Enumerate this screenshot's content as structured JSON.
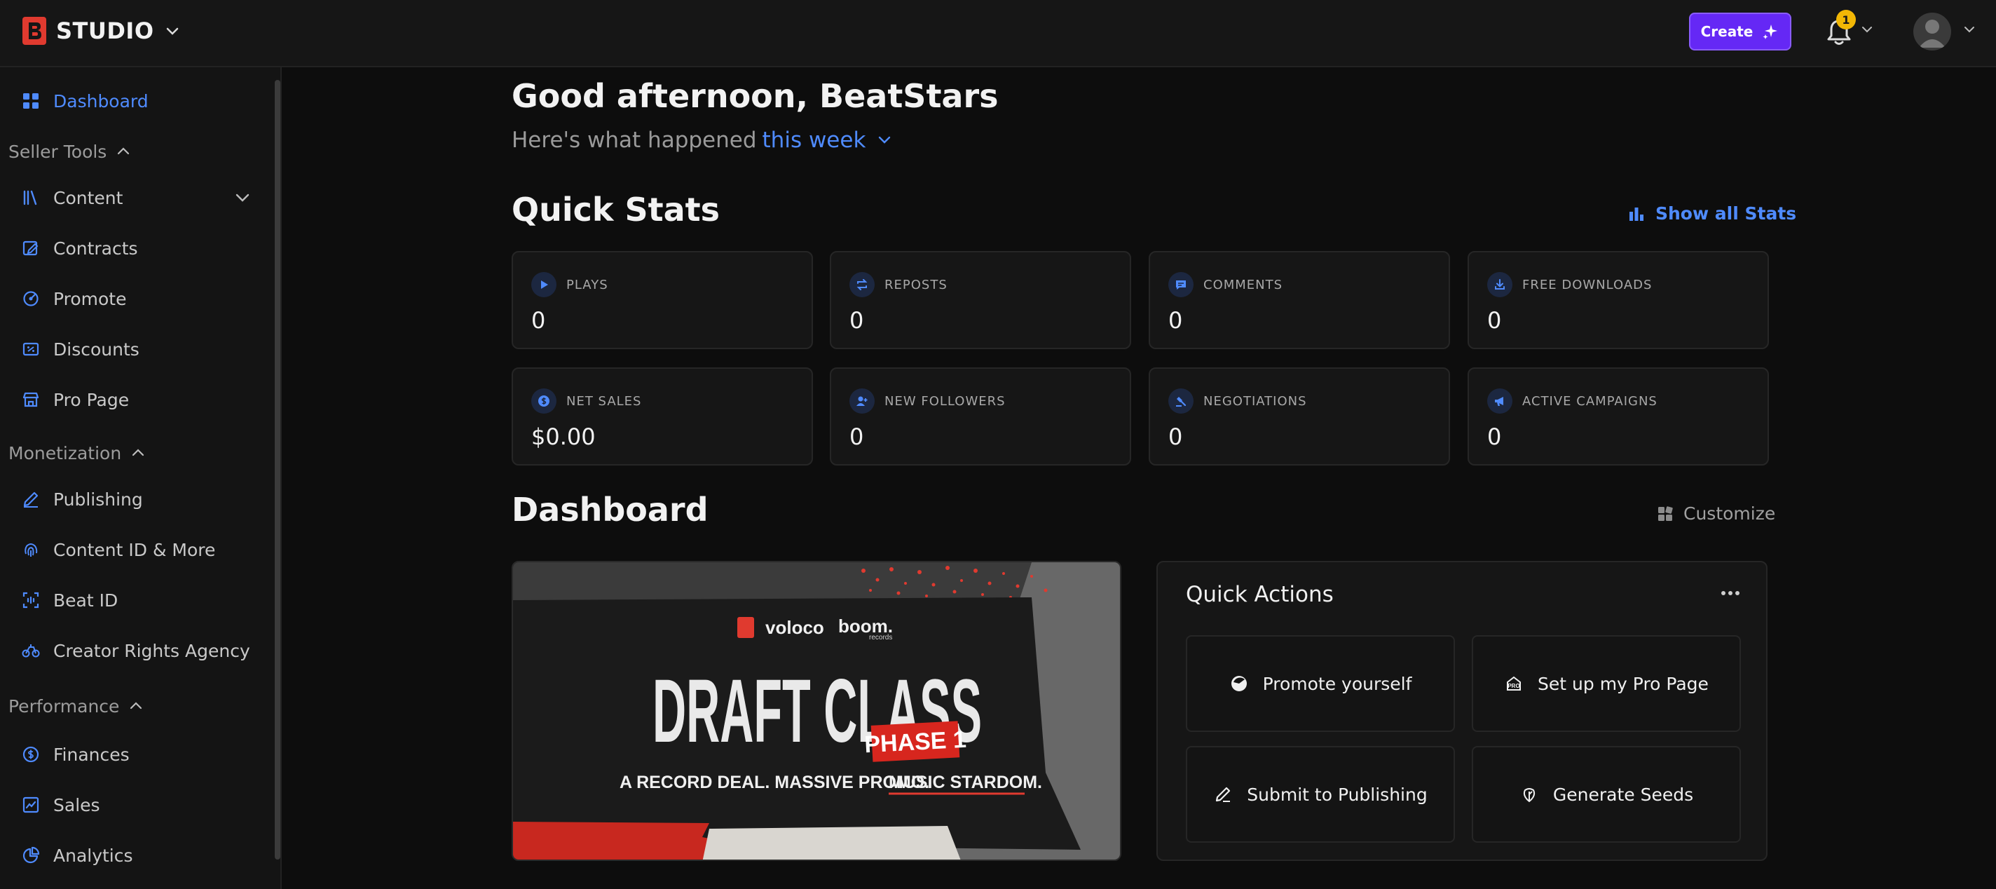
{
  "header": {
    "brand": "STUDIO",
    "create_label": "Create",
    "notification_count": "1"
  },
  "sidebar": {
    "dashboard": "Dashboard",
    "sections": {
      "seller_tools": "Seller Tools",
      "monetization": "Monetization",
      "performance": "Performance"
    },
    "items": {
      "content": "Content",
      "contracts": "Contracts",
      "promote": "Promote",
      "discounts": "Discounts",
      "pro_page": "Pro Page",
      "publishing": "Publishing",
      "content_id": "Content ID & More",
      "beat_id": "Beat ID",
      "creator_rights": "Creator Rights Agency",
      "finances": "Finances",
      "sales": "Sales",
      "analytics": "Analytics"
    }
  },
  "main": {
    "greeting": "Good afternoon, BeatStars",
    "subtitle_prefix": "Here's what happened",
    "period": "this week",
    "quick_stats_title": "Quick Stats",
    "show_all_stats": "Show all Stats",
    "stats": [
      {
        "label": "PLAYS",
        "value": "0"
      },
      {
        "label": "REPOSTS",
        "value": "0"
      },
      {
        "label": "COMMENTS",
        "value": "0"
      },
      {
        "label": "FREE DOWNLOADS",
        "value": "0"
      },
      {
        "label": "NET SALES",
        "value": "$0.00"
      },
      {
        "label": "NEW FOLLOWERS",
        "value": "0"
      },
      {
        "label": "NEGOTIATIONS",
        "value": "0"
      },
      {
        "label": "ACTIVE CAMPAIGNS",
        "value": "0"
      }
    ],
    "dashboard_title": "Dashboard",
    "customize": "Customize",
    "banner": {
      "brand_left": "voloco",
      "brand_right": "boom.",
      "brand_sub": "records",
      "headline": "DRAFT CLASS",
      "phase": "PHASE 1",
      "tagline_prefix": "A RECORD DEAL. MASSIVE PROMO.",
      "tagline_emph": "MUSIC STARDOM."
    },
    "quick_actions": {
      "title": "Quick Actions",
      "items": [
        "Promote yourself",
        "Set up my Pro Page",
        "Submit to Publishing",
        "Generate Seeds"
      ]
    }
  },
  "colors": {
    "accent": "#4f8bff",
    "create": "#6528f5",
    "brand_red": "#e03a2f",
    "badge": "#f2b705"
  }
}
